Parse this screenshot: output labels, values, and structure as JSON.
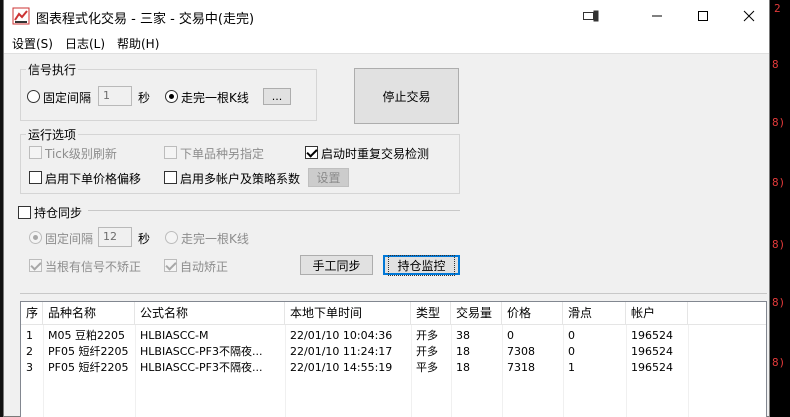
{
  "window": {
    "title": "图表程式化交易 - 三家 - 交易中(走完)"
  },
  "menu": [
    "设置(S)",
    "日志(L)",
    "帮助(H)"
  ],
  "signal": {
    "group_label": "信号执行",
    "fixed_interval_label": "固定间隔",
    "interval_value": "1",
    "unit": "秒",
    "bar_close_label": "走完一根K线",
    "browse_label": "...",
    "stop_button": "停止交易"
  },
  "run_options": {
    "group_label": "运行选项",
    "tick_refresh": "Tick级别刷新",
    "alt_symbol": "下单品种另指定",
    "restart_check": "启动时重复交易检测",
    "price_offset": "启用下单价格偏移",
    "multi_account": "启用多帐户及策略系数",
    "settings_button": "设置"
  },
  "position_sync": {
    "label": "持仓同步",
    "fixed_interval_label": "固定间隔",
    "interval_value": "12",
    "unit": "秒",
    "bar_close_label": "走完一根K线",
    "no_signal_label": "当根有信号不矫正",
    "auto_correct_label": "自动矫正",
    "manual_sync_button": "手工同步",
    "monitor_button": "持仓监控"
  },
  "table": {
    "headers": [
      "序",
      "品种名称",
      "公式名称",
      "本地下单时间",
      "类型",
      "交易量",
      "价格",
      "滑点",
      "帐户"
    ],
    "rows": [
      [
        "1",
        "M05 豆粕2205",
        "HLBIASCC-M",
        "22/01/10 10:04:36",
        "开多",
        "38",
        "0",
        "0",
        "196524"
      ],
      [
        "2",
        "PF05 短纤2205",
        "HLBIASCC-PF3不隔夜...",
        "22/01/10 11:24:17",
        "开多",
        "18",
        "7308",
        "0",
        "196524"
      ],
      [
        "3",
        "PF05 短纤2205",
        "HLBIASCC-PF3不隔夜...",
        "22/01/10 14:55:19",
        "平多",
        "18",
        "7318",
        "1",
        "196524"
      ]
    ]
  },
  "colors": {
    "accent": "#0078d7",
    "bg_red_text": "#e23a3a"
  }
}
